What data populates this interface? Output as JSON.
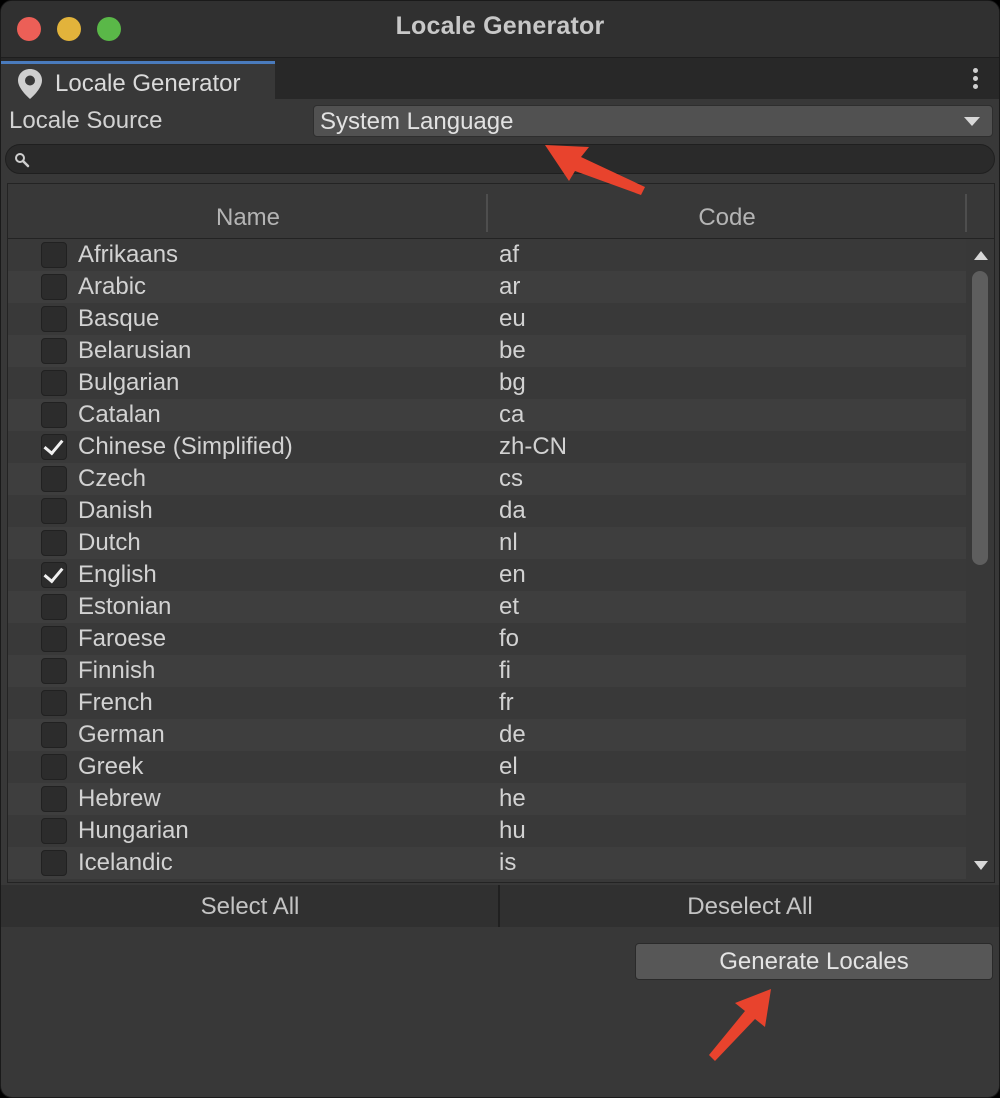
{
  "window": {
    "title": "Locale Generator"
  },
  "tab": {
    "label": "Locale Generator",
    "icon": "location-pin-icon"
  },
  "locale_source": {
    "label": "Locale Source",
    "value": "System Language"
  },
  "search": {
    "value": "",
    "placeholder": ""
  },
  "table": {
    "headers": {
      "name": "Name",
      "code": "Code"
    },
    "rows": [
      {
        "name": "Afrikaans",
        "code": "af",
        "checked": false
      },
      {
        "name": "Arabic",
        "code": "ar",
        "checked": false
      },
      {
        "name": "Basque",
        "code": "eu",
        "checked": false
      },
      {
        "name": "Belarusian",
        "code": "be",
        "checked": false
      },
      {
        "name": "Bulgarian",
        "code": "bg",
        "checked": false
      },
      {
        "name": "Catalan",
        "code": "ca",
        "checked": false
      },
      {
        "name": "Chinese (Simplified)",
        "code": "zh-CN",
        "checked": true
      },
      {
        "name": "Czech",
        "code": "cs",
        "checked": false
      },
      {
        "name": "Danish",
        "code": "da",
        "checked": false
      },
      {
        "name": "Dutch",
        "code": "nl",
        "checked": false
      },
      {
        "name": "English",
        "code": "en",
        "checked": true
      },
      {
        "name": "Estonian",
        "code": "et",
        "checked": false
      },
      {
        "name": "Faroese",
        "code": "fo",
        "checked": false
      },
      {
        "name": "Finnish",
        "code": "fi",
        "checked": false
      },
      {
        "name": "French",
        "code": "fr",
        "checked": false
      },
      {
        "name": "German",
        "code": "de",
        "checked": false
      },
      {
        "name": "Greek",
        "code": "el",
        "checked": false
      },
      {
        "name": "Hebrew",
        "code": "he",
        "checked": false
      },
      {
        "name": "Hungarian",
        "code": "hu",
        "checked": false
      },
      {
        "name": "Icelandic",
        "code": "is",
        "checked": false
      }
    ]
  },
  "buttons": {
    "select_all": "Select All",
    "deselect_all": "Deselect All",
    "generate": "Generate Locales"
  },
  "annotation_color": "#e8432d"
}
